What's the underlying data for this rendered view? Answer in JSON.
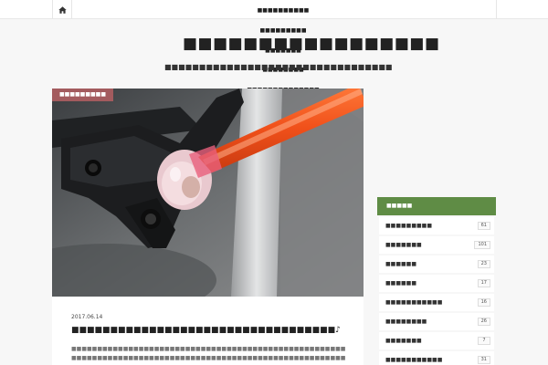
{
  "header": {
    "nav_items": [
      "■■■■■■■■■■",
      "■■■■■■■■■",
      "■■■■■■■",
      "■■■■■■■■",
      "■■■■■■■■■■■■■■",
      "■■■■■■■■■■■",
      "■■■"
    ],
    "site_title": "■■■■■■■■■■■■■■■■■",
    "site_description": "■■■■■■■■■■■■■■■■■■■■■■■■■■■■■■■■■"
  },
  "post": {
    "category": "■■■■■■■■■",
    "date": "2017.06.14",
    "title": "■■■■■■■■■■■■■■■■■■■■■■■■■■■■■■■■■■♪",
    "excerpt": [
      "■■■■■■■■■■■■■■■■■■■■■■■■■■■■■■■■■■■■■■■■■■■■■■■■■■■■■■■■■■■■■■■■■■■■■■■■■■■■■■■■■■■■■■■■",
      "■■■■■■■■■■■■■■■■■■■■■■■■■■■■■■■■■■■■■■■■■■■■■■■■■■■■■■■■■■■■■■■■■■■■■■■■■■■■■■■■■■■■■■■■"
    ]
  },
  "sidebar": {
    "widget_title": "■■■■■",
    "categories": [
      {
        "label": "■■■■■■■■■",
        "count": "61"
      },
      {
        "label": "■■■■■■■",
        "count": "101"
      },
      {
        "label": "■■■■■■",
        "count": "23"
      },
      {
        "label": "■■■■■■",
        "count": "17"
      },
      {
        "label": "■■■■■■■■■■■",
        "count": "16"
      },
      {
        "label": "■■■■■■■■",
        "count": "26"
      },
      {
        "label": "■■■■■■■",
        "count": "7"
      },
      {
        "label": "■■■■■■■■■■■",
        "count": "31"
      }
    ]
  },
  "colors": {
    "category_badge": "#a35b5e",
    "widget_header": "#5f8c45",
    "background": "#f7f7f7"
  },
  "icons": {
    "home": "home-icon"
  }
}
